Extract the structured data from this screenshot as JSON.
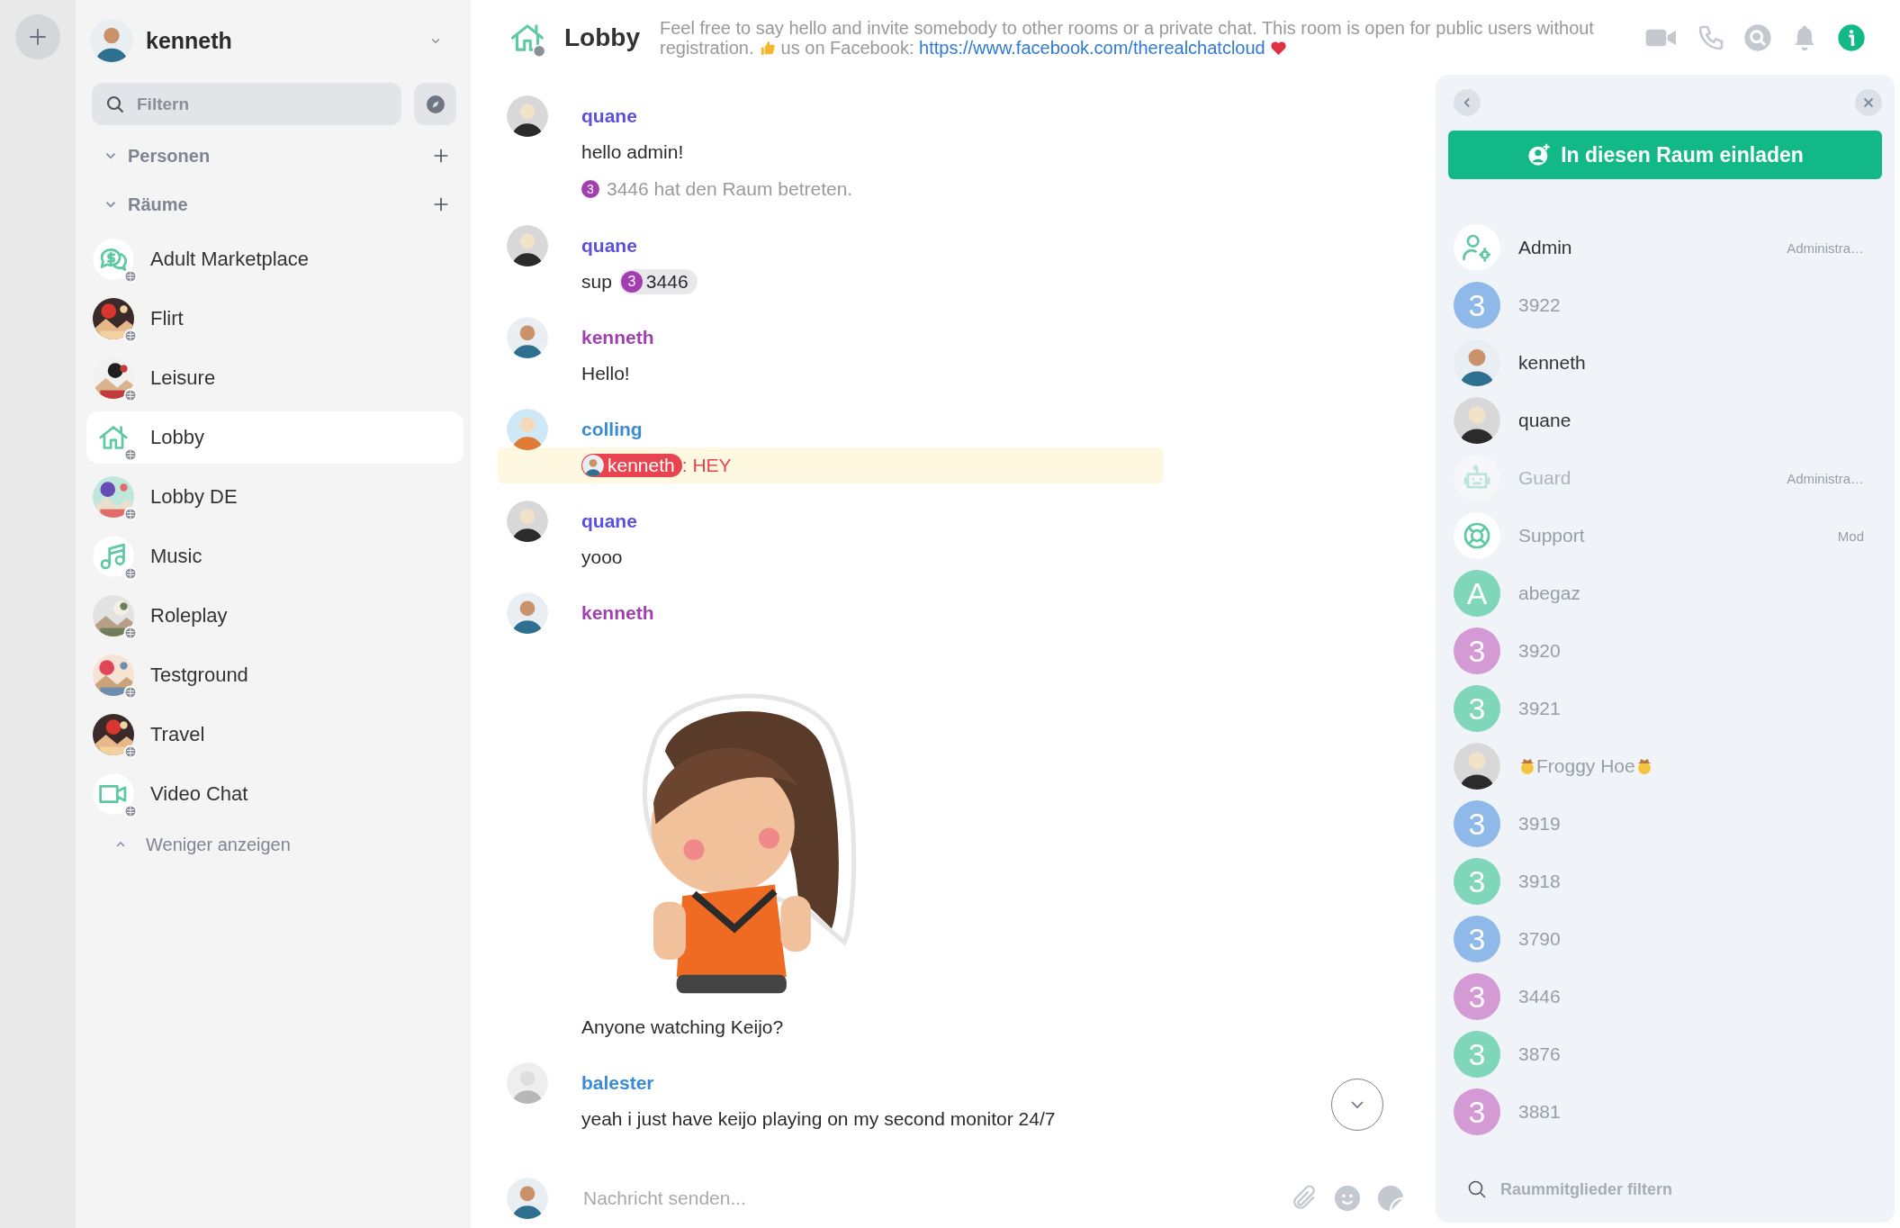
{
  "user": {
    "name": "kenneth"
  },
  "search": {
    "placeholder": "Filtern"
  },
  "sections": [
    {
      "title": "Personen",
      "expanded": true
    },
    {
      "title": "Räume",
      "expanded": true
    }
  ],
  "rooms": [
    {
      "name": "Adult Marketplace",
      "kind": "icon",
      "selected": false
    },
    {
      "name": "Flirt",
      "kind": "picture",
      "selected": false
    },
    {
      "name": "Leisure",
      "kind": "picture",
      "selected": false
    },
    {
      "name": "Lobby",
      "kind": "icon",
      "selected": true
    },
    {
      "name": "Lobby DE",
      "kind": "picture",
      "selected": false
    },
    {
      "name": "Music",
      "kind": "icon",
      "selected": false
    },
    {
      "name": "Roleplay",
      "kind": "picture",
      "selected": false
    },
    {
      "name": "Testground",
      "kind": "picture",
      "selected": false
    },
    {
      "name": "Travel",
      "kind": "picture",
      "selected": false
    },
    {
      "name": "Video Chat",
      "kind": "icon",
      "selected": false
    }
  ],
  "show_less": "Weniger anzeigen",
  "room": {
    "title": "Lobby",
    "topic_1": "Feel free to say hello and invite somebody to other rooms or a private chat. This room is open for public users without registration.",
    "topic_2": "us on Facebook:",
    "link": "https://www.facebook.com/therealchatcloud"
  },
  "messages": [
    {
      "author": "quane",
      "color": "#5b4fe0",
      "highlighted": false,
      "lines": [
        {
          "kind": "text",
          "text": "hello admin!"
        },
        {
          "kind": "system",
          "badge": "3",
          "text": "3446 hat den Raum betreten."
        }
      ]
    },
    {
      "author": "quane",
      "color": "#5b4fe0",
      "highlighted": false,
      "lines": [
        {
          "kind": "text_mention",
          "text": "sup",
          "badge": "3",
          "mention": "3446"
        }
      ]
    },
    {
      "author": "kenneth",
      "color": "#a23fb0",
      "highlighted": false,
      "lines": [
        {
          "kind": "text",
          "text": "Hello!"
        }
      ]
    },
    {
      "author": "colling",
      "color": "#3a8ad6",
      "highlighted": true,
      "lines": [
        {
          "kind": "reply_mention",
          "mention": "kenneth",
          "text": ": HEY"
        }
      ]
    },
    {
      "author": "quane",
      "color": "#5b4fe0",
      "highlighted": false,
      "lines": [
        {
          "kind": "text",
          "text": "yooo"
        }
      ]
    },
    {
      "author": "kenneth",
      "color": "#a23fb0",
      "highlighted": false,
      "lines": [
        {
          "kind": "sticker"
        },
        {
          "kind": "text",
          "text": "Anyone watching Keijo?"
        }
      ]
    },
    {
      "author": "balester",
      "color": "#3a8ad6",
      "highlighted": false,
      "lines": [
        {
          "kind": "text",
          "text": "yeah i just have keijo playing on my second monitor 24/7"
        }
      ]
    }
  ],
  "composer": {
    "placeholder": "Nachricht senden..."
  },
  "panel": {
    "invite_button": "In diesen Raum einladen",
    "filter_placeholder": "Raummitglieder filtern"
  },
  "members": [
    {
      "name": "Admin",
      "role": "Administra…",
      "kind": "icon",
      "online": true,
      "disabled": false
    },
    {
      "name": "3922",
      "kind": "letter",
      "letter": "3",
      "color": "#8fb9e8",
      "online": false,
      "disabled": false
    },
    {
      "name": "kenneth",
      "kind": "picture",
      "online": true,
      "disabled": false
    },
    {
      "name": "quane",
      "kind": "picture",
      "online": true,
      "disabled": false
    },
    {
      "name": "Guard",
      "role": "Administra…",
      "kind": "icon",
      "online": false,
      "disabled": true
    },
    {
      "name": "Support",
      "role": "Mod",
      "kind": "icon",
      "online": false,
      "disabled": false
    },
    {
      "name": "abegaz",
      "kind": "letter",
      "letter": "A",
      "color": "#7fd6b9",
      "online": false,
      "disabled": false
    },
    {
      "name": "3920",
      "kind": "letter",
      "letter": "3",
      "color": "#d49ad6",
      "online": false,
      "disabled": false
    },
    {
      "name": "3921",
      "kind": "letter",
      "letter": "3",
      "color": "#7fd6b9",
      "online": false,
      "disabled": false
    },
    {
      "name": "Froggy Hoe",
      "kind": "picture",
      "online": false,
      "disabled": false
    },
    {
      "name": "3919",
      "kind": "letter",
      "letter": "3",
      "color": "#8fb9e8",
      "online": false,
      "disabled": false
    },
    {
      "name": "3918",
      "kind": "letter",
      "letter": "3",
      "color": "#7fd6b9",
      "online": false,
      "disabled": false
    },
    {
      "name": "3790",
      "kind": "letter",
      "letter": "3",
      "color": "#8fb9e8",
      "online": false,
      "disabled": false
    },
    {
      "name": "3446",
      "kind": "letter",
      "letter": "3",
      "color": "#d49ad6",
      "online": false,
      "disabled": false
    },
    {
      "name": "3876",
      "kind": "letter",
      "letter": "3",
      "color": "#7fd6b9",
      "online": false,
      "disabled": false
    },
    {
      "name": "3881",
      "kind": "letter",
      "letter": "3",
      "color": "#d49ad6",
      "online": false,
      "disabled": false
    }
  ]
}
